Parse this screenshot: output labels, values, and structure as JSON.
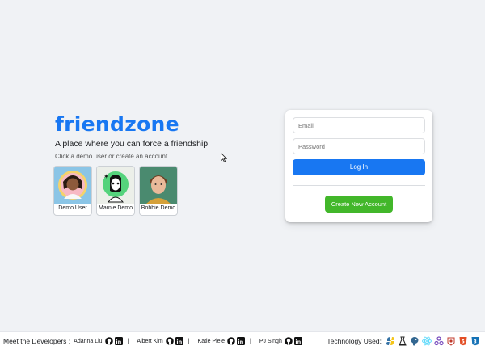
{
  "brand": {
    "logo": "friendzone",
    "tagline": "A place where you can force a friendship",
    "hint": "Click a demo user or create an account"
  },
  "demo_users": [
    {
      "name": "Demo User"
    },
    {
      "name": "Marnie Demo"
    },
    {
      "name": "Bobbie Demo"
    }
  ],
  "login": {
    "email_placeholder": "Email",
    "password_placeholder": "Password",
    "login_label": "Log In",
    "create_label": "Create New Account"
  },
  "footer": {
    "developers_label": "Meet the Developers :",
    "developers": [
      "Adanna Liu",
      "Albert Kim",
      "Katie Piele",
      "PJ Singh"
    ],
    "separator": "|",
    "tech_label": "Technology Used:",
    "tech_icons": [
      "python-icon",
      "flask-icon",
      "postgresql-icon",
      "react-icon",
      "redux-icon",
      "sqlalchemy-icon",
      "html5-icon",
      "css3-icon"
    ]
  },
  "colors": {
    "brand_blue": "#1877f2",
    "create_green": "#42b72a",
    "background": "#f0f2f5"
  }
}
